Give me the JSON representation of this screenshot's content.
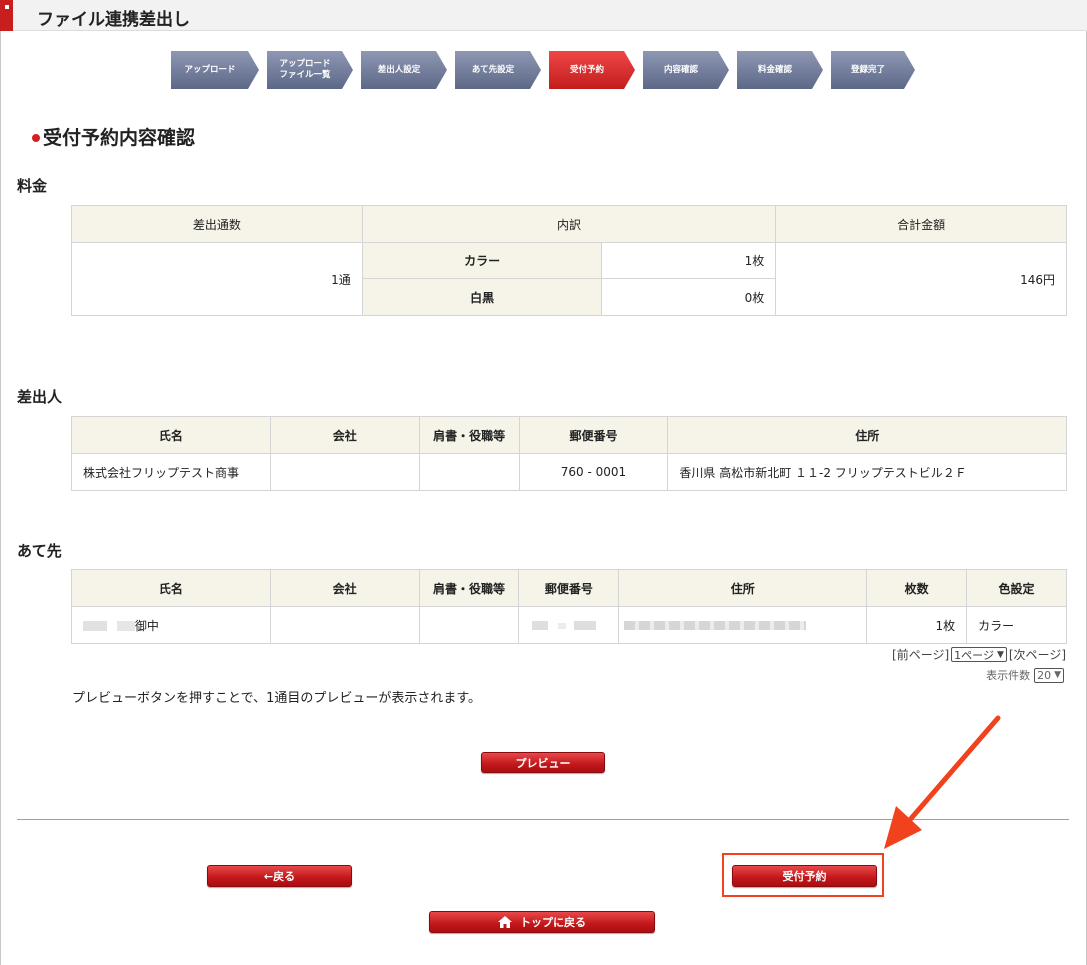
{
  "header": {
    "title": "ファイル連携差出し"
  },
  "steps": [
    {
      "line1": "アップロード",
      "line2": ""
    },
    {
      "line1": "アップロード",
      "line2": "ファイル一覧"
    },
    {
      "line1": "差出人設定",
      "line2": ""
    },
    {
      "line1": "あて先設定",
      "line2": ""
    },
    {
      "line1": "受付予約",
      "line2": ""
    },
    {
      "line1": "内容確認",
      "line2": ""
    },
    {
      "line1": "料金確認",
      "line2": ""
    },
    {
      "line1": "登録完了",
      "line2": ""
    }
  ],
  "page_title": "受付予約内容確認",
  "fee": {
    "section_label": "料金",
    "headers": {
      "count": "差出通数",
      "breakdown": "内訳",
      "total": "合計金額"
    },
    "count_value": "1通",
    "rows": [
      {
        "label": "カラー",
        "value": "1枚"
      },
      {
        "label": "白黒",
        "value": "0枚"
      }
    ],
    "total_value": "146円"
  },
  "sender": {
    "section_label": "差出人",
    "headers": {
      "name": "氏名",
      "company": "会社",
      "title": "肩書・役職等",
      "postal": "郵便番号",
      "address": "住所"
    },
    "row": {
      "name": "株式会社フリップテスト商事",
      "company": "",
      "title": "",
      "postal": "760 - 0001",
      "address": "香川県 高松市新北町 １１-2 フリップテストビル２Ｆ"
    }
  },
  "recipient": {
    "section_label": "あて先",
    "headers": {
      "name": "氏名",
      "company": "会社",
      "title": "肩書・役職等",
      "postal": "郵便番号",
      "address": "住所",
      "sheets": "枚数",
      "color": "色設定"
    },
    "row": {
      "name_suffix": "御中",
      "company": "",
      "title": "",
      "sheets": "1枚",
      "color": "カラー"
    }
  },
  "pager": {
    "prev": "[前ページ]",
    "page_select": "1ページ",
    "next": "[次ページ]",
    "count_label": "表示件数",
    "count_select": "20"
  },
  "note": "プレビューボタンを押すことで、1通目のプレビューが表示されます。",
  "buttons": {
    "preview": "プレビュー",
    "back": "←戻る",
    "reserve": "受付予約",
    "top": "トップに戻る"
  },
  "colors": {
    "accent_red": "#c81e1e",
    "annotation": "#f0421d",
    "header_bg": "#f6f4e8",
    "step_blue": "#6b7594"
  }
}
